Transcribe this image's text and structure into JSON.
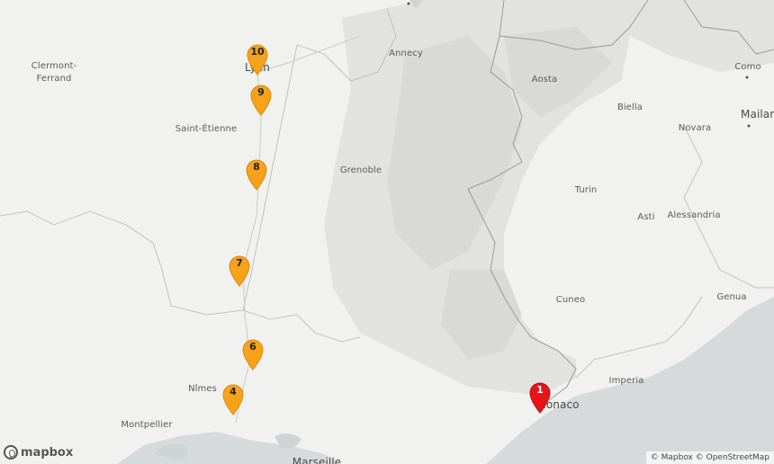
{
  "map": {
    "colors": {
      "land": "#f1f1f0",
      "sea": "#d6dadb",
      "mountain_shade": "#dcdcdc",
      "border": "#9a9a9a",
      "marker_orange": "#f7a21b",
      "marker_red": "#e8141a"
    },
    "places": {
      "clermont": "Clermont-\nFerrand",
      "lyon": "Lyon",
      "annecy": "Annecy",
      "aosta": "Aosta",
      "biella": "Biella",
      "novara": "Novara",
      "como": "Como",
      "milan": "Mailan",
      "saint_etienne": "Saint-Étienne",
      "grenoble": "Grenoble",
      "turin": "Turin",
      "asti": "Asti",
      "alessandria": "Alessandria",
      "genua": "Genua",
      "cuneo": "Cuneo",
      "imperia": "Imperia",
      "nimes": "Nîmes",
      "montpellier": "Montpellier",
      "monaco": "Monaco",
      "marseille": "Marseille"
    },
    "markers": [
      {
        "label": "10",
        "color": "orange"
      },
      {
        "label": "9",
        "color": "orange"
      },
      {
        "label": "8",
        "color": "orange"
      },
      {
        "label": "7",
        "color": "orange"
      },
      {
        "label": "6",
        "color": "orange"
      },
      {
        "label": "4",
        "color": "orange"
      },
      {
        "label": "1",
        "color": "red"
      }
    ],
    "logo_text": "mapbox",
    "attribution": "© Mapbox © OpenStreetMap"
  }
}
